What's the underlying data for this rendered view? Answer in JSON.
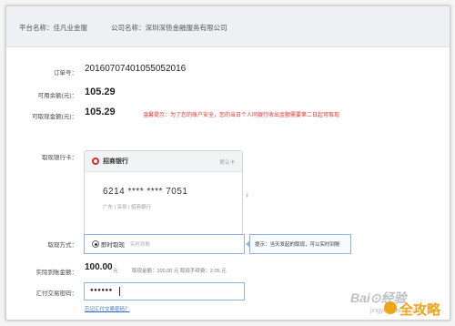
{
  "header": {
    "platform_label": "平台名称：",
    "platform_name": "佳凡业金服",
    "company_label": "公司名称：",
    "company_name": "深圳深债金融服务有限公司"
  },
  "order": {
    "order_no_label": "订单号：",
    "order_no": "2016070740105505​2016",
    "available_label": "可用余额(元)：",
    "available": "105.29",
    "withdrawable_label": "可取现金额(元)：",
    "withdrawable": "105.29",
    "warning": "温馨提示：为了您的账户安全，您的当日个人同银行收出金额需要第二日起可取现"
  },
  "bank": {
    "section_label": "取现银行卡：",
    "bank_name": "招商银行",
    "default_label": "默认卡",
    "card_number": "6214 **** **** 7051",
    "card_meta": "广东 | 深圳 | 招商银行",
    "logo_color": "#d72b2b"
  },
  "method": {
    "section_label": "取现方式：",
    "option_label": "即时取现",
    "option_note": "实时到账",
    "tip": "提示：当天发起的取现，可以实时到账"
  },
  "payment": {
    "actual_label": "实际到账金额：",
    "actual_value": "100.00",
    "unit": "元",
    "breakdown": "取现金额：100.00 元    取现手续费：2.05 元"
  },
  "password": {
    "label": "汇付交易密码：",
    "masked_value": "●●●●●●",
    "forgot_link": "忘记汇付交易密码？"
  },
  "watermark": {
    "baidu": "Bai⊙经验",
    "jingyan": "jingyan.baidu.com",
    "brand": "全攻略"
  },
  "colors": {
    "accent_blue": "#8fb3d9",
    "warning_red": "#e0322d",
    "brand_orange": "#f0a419"
  }
}
